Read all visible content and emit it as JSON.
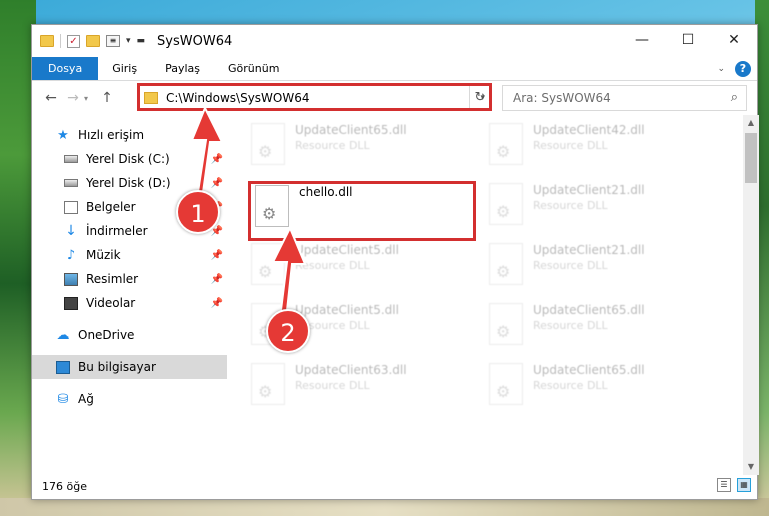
{
  "window": {
    "title": "SysWOW64",
    "controls": {
      "minimize": "—",
      "maximize": "☐",
      "close": "✕"
    }
  },
  "ribbon": {
    "tabs": [
      "Dosya",
      "Giriş",
      "Paylaş",
      "Görünüm"
    ],
    "help": "?"
  },
  "address": {
    "path": "C:\\Windows\\SysWOW64",
    "search_placeholder": "Ara: SysWOW64"
  },
  "sidebar": {
    "items": [
      {
        "label": "Hızlı erişim",
        "icon": "star-icon"
      },
      {
        "label": "Yerel Disk (C:)",
        "icon": "disk-icon",
        "pinned": true
      },
      {
        "label": "Yerel Disk (D:)",
        "icon": "disk-icon",
        "pinned": true
      },
      {
        "label": "Belgeler",
        "icon": "document-icon",
        "pinned": true
      },
      {
        "label": "İndirmeler",
        "icon": "download-icon",
        "pinned": true
      },
      {
        "label": "Müzik",
        "icon": "music-icon",
        "pinned": true
      },
      {
        "label": "Resimler",
        "icon": "pictures-icon",
        "pinned": true
      },
      {
        "label": "Videolar",
        "icon": "videos-icon",
        "pinned": true
      },
      {
        "label": "OneDrive",
        "icon": "cloud-icon"
      },
      {
        "label": "Bu bilgisayar",
        "icon": "computer-icon",
        "selected": true
      },
      {
        "label": "Ağ",
        "icon": "network-icon"
      }
    ]
  },
  "files": [
    {
      "name": "UpdateClient65.dll",
      "desc": "Resource DLL",
      "faded": true
    },
    {
      "name": "UpdateClient42.dll",
      "desc": "Resource DLL",
      "faded": true
    },
    {
      "name": "chello.dll",
      "desc": "",
      "faded": false
    },
    {
      "name": "UpdateClient21.dll",
      "desc": "Resource DLL",
      "faded": true
    },
    {
      "name": "UpdateClient5.dll",
      "desc": "Resource DLL",
      "faded": true
    },
    {
      "name": "UpdateClient21.dll",
      "desc": "Resource DLL",
      "faded": true
    },
    {
      "name": "UpdateClient5.dll",
      "desc": "Resource DLL",
      "faded": true
    },
    {
      "name": "UpdateClient65.dll",
      "desc": "Resource DLL",
      "faded": true
    },
    {
      "name": "UpdateClient63.dll",
      "desc": "Resource DLL",
      "faded": true
    },
    {
      "name": "UpdateClient65.dll",
      "desc": "Resource DLL",
      "faded": true
    }
  ],
  "status": {
    "count": "176 öğe"
  },
  "annotations": {
    "badge1": "1",
    "badge2": "2",
    "color": "#e53935"
  }
}
